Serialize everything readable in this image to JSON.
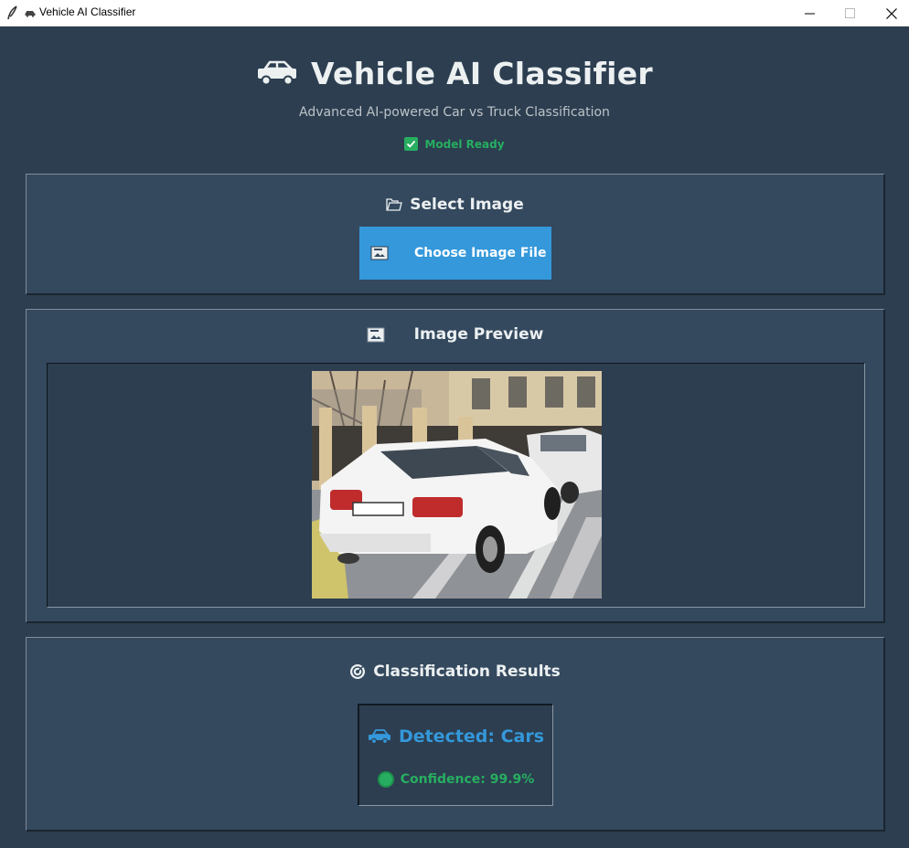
{
  "window": {
    "title": "Vehicle AI Classifier"
  },
  "header": {
    "title": "Vehicle AI Classifier",
    "subtitle": "Advanced AI-powered Car vs Truck Classification",
    "status": "Model Ready"
  },
  "select_panel": {
    "title": "Select Image",
    "button_label": "Choose Image File"
  },
  "preview_panel": {
    "title": "Image Preview"
  },
  "results_panel": {
    "title": "Classification Results",
    "detected": "Detected: Cars",
    "confidence": "Confidence: 99.9%"
  },
  "colors": {
    "background": "#2c3e50",
    "panel": "#34495e",
    "accent_blue": "#3498db",
    "success_green": "#27ae60",
    "text_light": "#ecf0f1"
  },
  "icons": [
    "feather-icon",
    "car-icon",
    "folder-icon",
    "picture-icon",
    "target-icon",
    "check-icon"
  ]
}
